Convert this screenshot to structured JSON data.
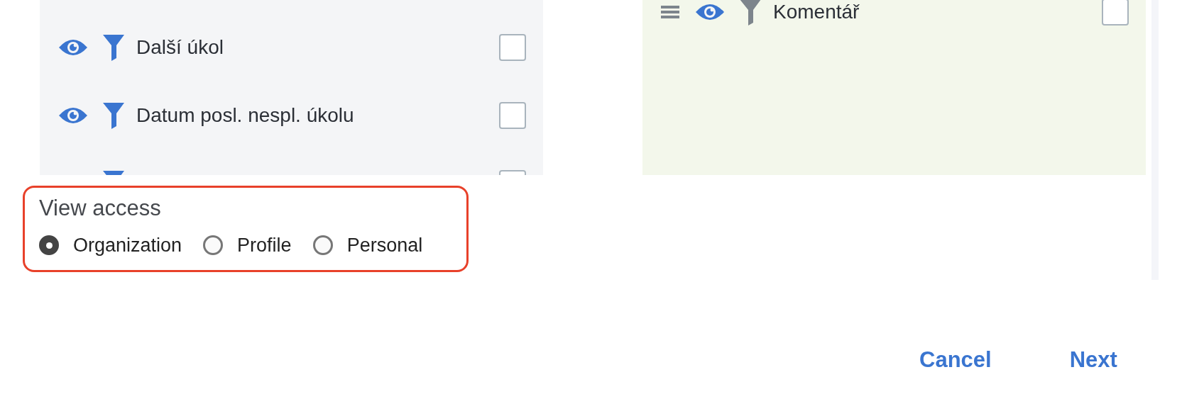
{
  "left_fields": [
    {
      "label": "Další úkol",
      "visible": true,
      "checked": false
    },
    {
      "label": "Datum posl. nespl. úkolu",
      "visible": true,
      "checked": false
    },
    {
      "checked": false
    }
  ],
  "right_fields": [
    {
      "label": "Komentář",
      "visible": true,
      "checked": false
    }
  ],
  "view_access": {
    "title": "View access",
    "options": [
      {
        "label": "Organization",
        "selected": true
      },
      {
        "label": "Profile",
        "selected": false
      },
      {
        "label": "Personal",
        "selected": false
      }
    ]
  },
  "buttons": [
    {
      "label": "Cancel"
    },
    {
      "label": "Next"
    }
  ]
}
